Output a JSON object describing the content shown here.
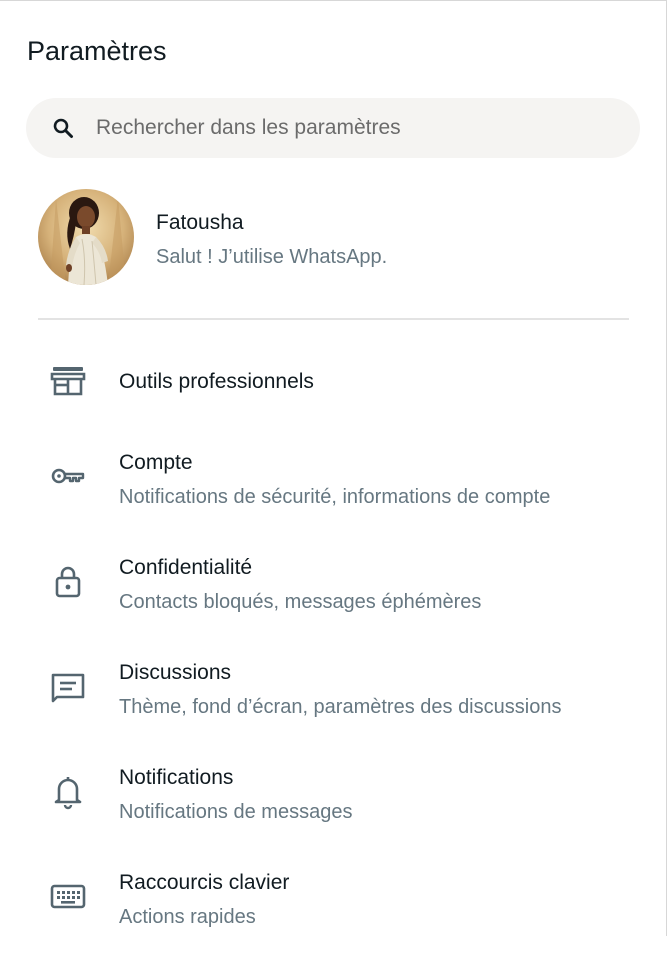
{
  "header": {
    "title": "Paramètres"
  },
  "search": {
    "placeholder": "Rechercher dans les paramètres",
    "value": "",
    "icon": "search-icon"
  },
  "profile": {
    "name": "Fatousha",
    "status": "Salut ! J’utilise WhatsApp."
  },
  "menu": {
    "items": [
      {
        "icon": "store-icon",
        "label": "Outils professionnels",
        "sub": ""
      },
      {
        "icon": "key-icon",
        "label": "Compte",
        "sub": "Notifications de sécurité, informations de compte"
      },
      {
        "icon": "lock-icon",
        "label": "Confidentialité",
        "sub": "Contacts bloqués, messages éphémères"
      },
      {
        "icon": "chat-icon",
        "label": "Discussions",
        "sub": "Thème, fond d’écran, paramètres des discussions"
      },
      {
        "icon": "bell-icon",
        "label": "Notifications",
        "sub": "Notifications de messages"
      },
      {
        "icon": "keyboard-icon",
        "label": "Raccourcis clavier",
        "sub": "Actions rapides"
      }
    ]
  },
  "colors": {
    "primary_text": "#111b21",
    "secondary_text": "#667781",
    "search_bg": "#f5f4f2",
    "divider": "#e3e3e3",
    "icon": "#54656f"
  }
}
